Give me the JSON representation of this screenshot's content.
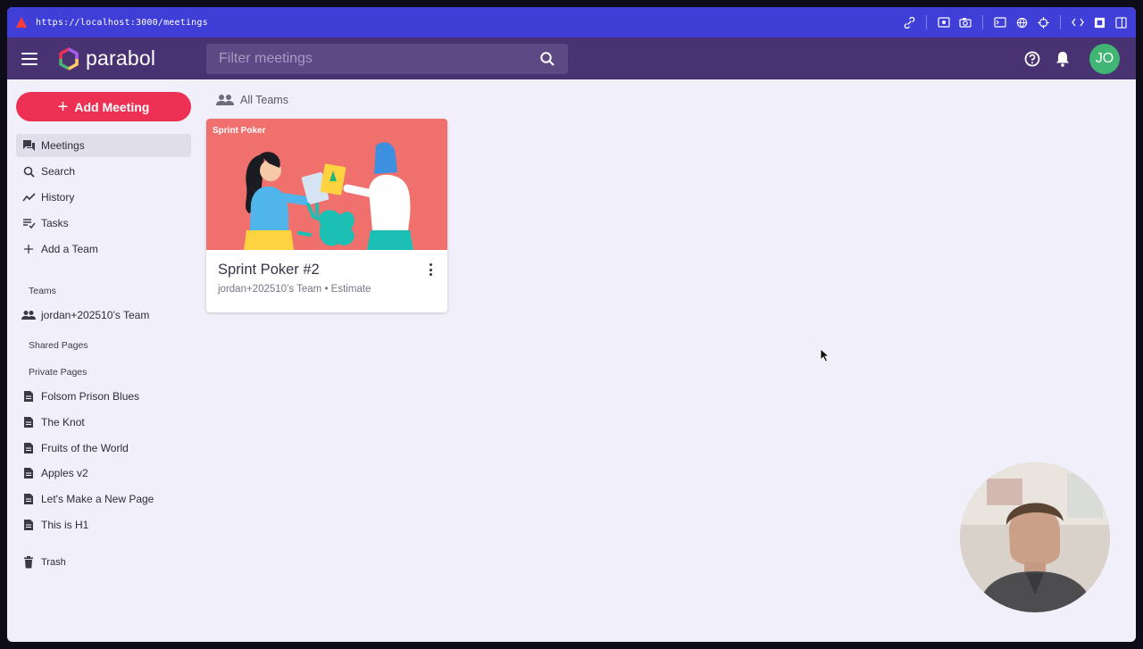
{
  "browser": {
    "url": "https://localhost:3000/meetings"
  },
  "header": {
    "brand": "parabol",
    "search_placeholder": "Filter meetings",
    "avatar_initials": "JO"
  },
  "sidebar": {
    "add_meeting_label": "Add Meeting",
    "nav": [
      {
        "label": "Meetings",
        "icon": "forum-icon",
        "active": true
      },
      {
        "label": "Search",
        "icon": "search-icon"
      },
      {
        "label": "History",
        "icon": "timeline-icon"
      },
      {
        "label": "Tasks",
        "icon": "playlist-check-icon"
      },
      {
        "label": "Add a Team",
        "icon": "plus-icon"
      }
    ],
    "teams_label": "Teams",
    "teams": [
      {
        "label": "jordan+202510’s Team",
        "icon": "group-icon"
      }
    ],
    "shared_pages_label": "Shared Pages",
    "private_pages_label": "Private Pages",
    "pages": [
      {
        "label": "Folsom Prison Blues"
      },
      {
        "label": "The Knot"
      },
      {
        "label": "Fruits of the World"
      },
      {
        "label": "Apples v2"
      },
      {
        "label": "Let's Make a New Page"
      },
      {
        "label": "This is H1"
      }
    ],
    "trash_label": "Trash"
  },
  "main": {
    "team_filter_label": "All Teams",
    "meetings": [
      {
        "tag": "Sprint Poker",
        "title": "Sprint Poker #2",
        "subtitle": "jordan+202510’s Team • Estimate"
      }
    ]
  },
  "colors": {
    "url_bar": "#3f3fd8",
    "app_bar": "#493272",
    "accent": "#ed3154",
    "card_art": "#f0706d",
    "avatar": "#40b574"
  }
}
